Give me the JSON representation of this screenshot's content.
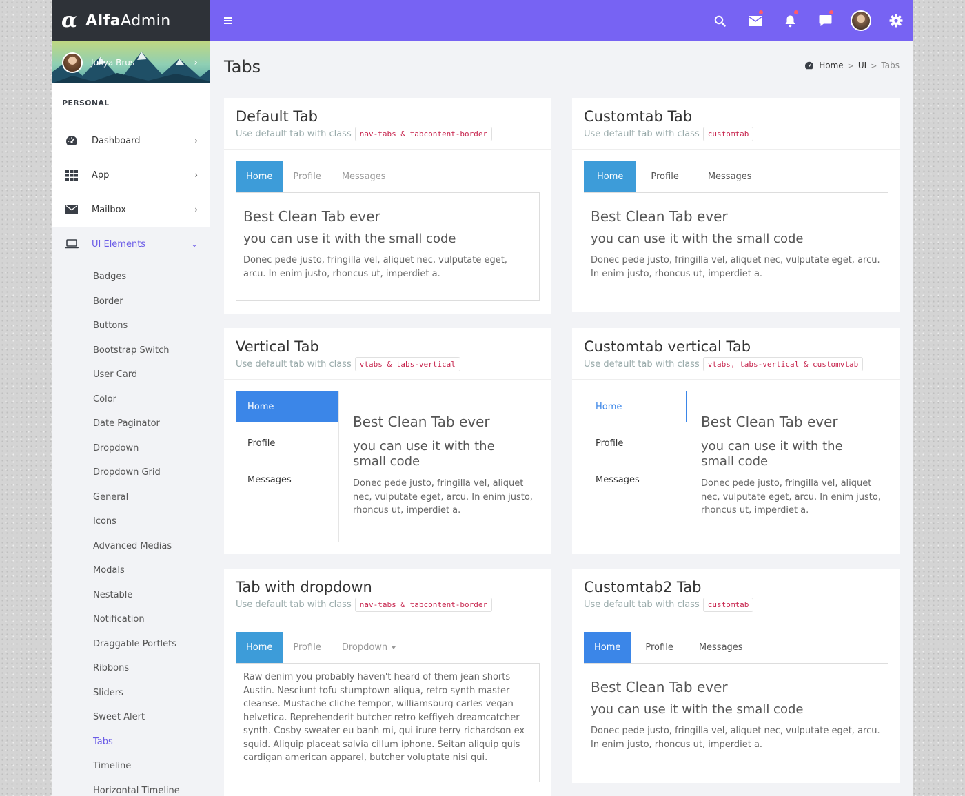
{
  "brand": {
    "mark": "α",
    "name_bold": "Alfa",
    "name_rest": "Admin"
  },
  "user": {
    "name": "Juliya Brus"
  },
  "sidebar": {
    "section": "PERSONAL",
    "items": [
      {
        "label": "Dashboard",
        "icon": "dashboard-icon"
      },
      {
        "label": "App",
        "icon": "grid-icon"
      },
      {
        "label": "Mailbox",
        "icon": "envelope-icon"
      },
      {
        "label": "UI Elements",
        "icon": "laptop-icon"
      }
    ],
    "subitems": [
      "Badges",
      "Border",
      "Buttons",
      "Bootstrap Switch",
      "User Card",
      "Color",
      "Date Paginator",
      "Dropdown",
      "Dropdown Grid",
      "General",
      "Icons",
      "Advanced Medias",
      "Modals",
      "Nestable",
      "Notification",
      "Draggable Portlets",
      "Ribbons",
      "Sliders",
      "Sweet Alert",
      "Tabs",
      "Timeline",
      "Horizontal Timeline"
    ]
  },
  "topbar": {
    "icons": [
      "search-icon",
      "mail-icon",
      "bell-icon",
      "chat-icon",
      "avatar",
      "gear-icon"
    ]
  },
  "page": {
    "title": "Tabs"
  },
  "breadcrumb": {
    "home": "Home",
    "ui": "UI",
    "current": "Tabs"
  },
  "common": {
    "sub_prefix": "Use default tab with class",
    "tab_home": "Home",
    "tab_profile": "Profile",
    "tab_messages": "Messages",
    "tab_dropdown": "Dropdown",
    "h1": "Best Clean Tab ever",
    "h2": "you can use it with the small code",
    "h2_wrap1": "you can use it with the",
    "h2_wrap2": "small code",
    "para": "Donec pede justo, fringilla vel, aliquet nec, vulputate eget, arcu. In enim justo, rhoncus ut, imperdiet a.",
    "long_para": "Raw denim you probably haven't heard of them jean shorts Austin. Nesciunt tofu stumptown aliqua, retro synth master cleanse. Mustache cliche tempor, williamsburg carles vegan helvetica. Reprehenderit butcher retro keffiyeh dreamcatcher synth. Cosby sweater eu banh mi, qui irure terry richardson ex squid. Aliquip placeat salvia cillum iphone. Seitan aliquip quis cardigan american apparel, butcher voluptate nisi qui."
  },
  "cards": {
    "default": {
      "title": "Default Tab",
      "code": "nav-tabs & tabcontent-border"
    },
    "custom": {
      "title": "Customtab Tab",
      "code": "customtab"
    },
    "vertical": {
      "title": "Vertical Tab",
      "code": "vtabs & tabs-vertical"
    },
    "customv": {
      "title": "Customtab vertical Tab",
      "code": "vtabs, tabs-vertical & customvtab"
    },
    "dropdown": {
      "title": "Tab with dropdown",
      "code": "nav-tabs & tabcontent-border"
    },
    "custom2": {
      "title": "Customtab2 Tab",
      "code": "customtab"
    }
  }
}
